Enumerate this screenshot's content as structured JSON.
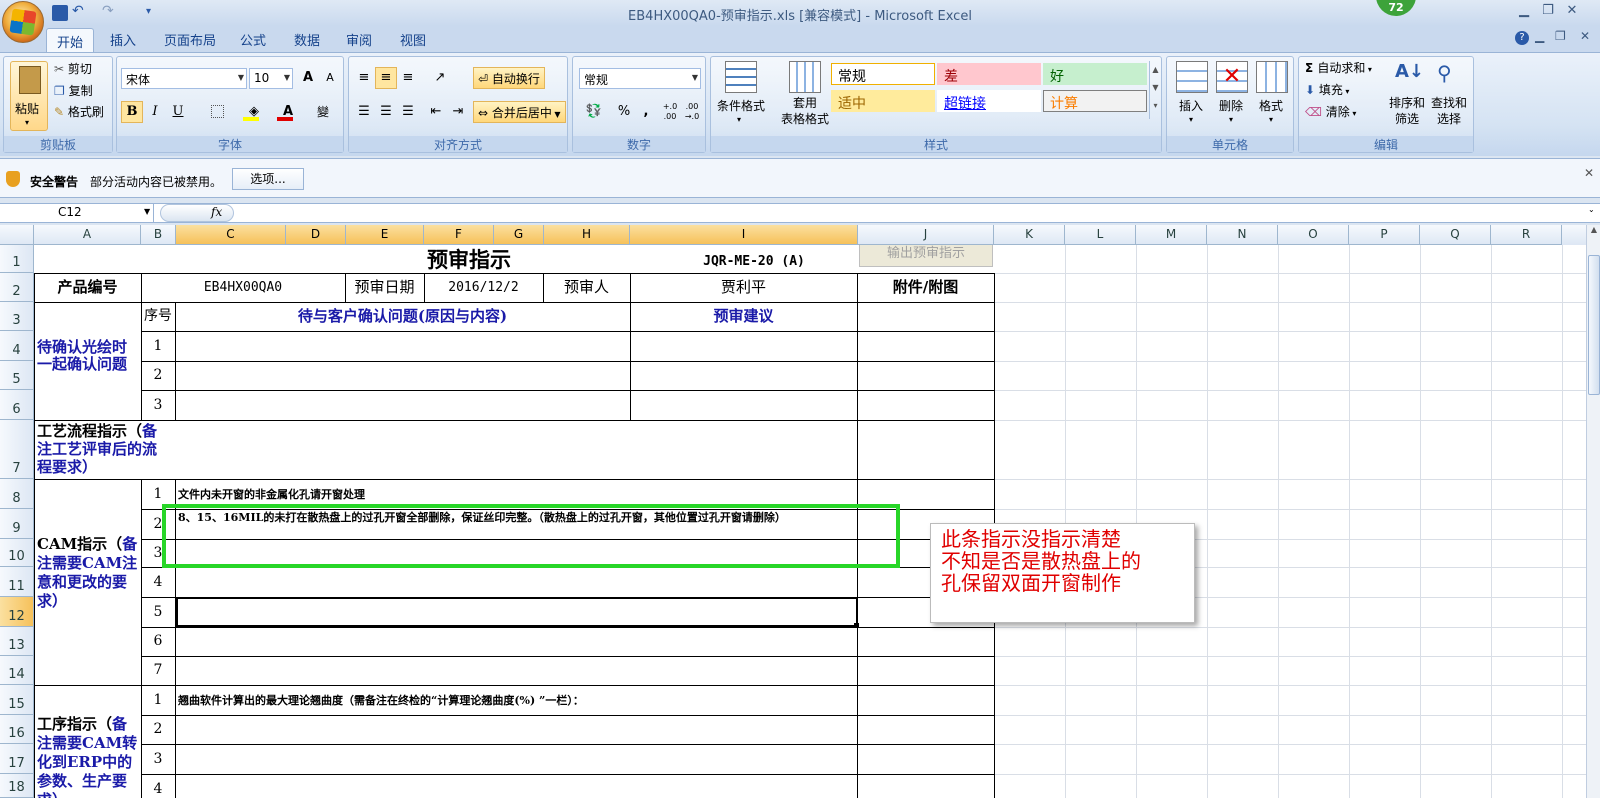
{
  "window": {
    "title": "EB4HX00QA0-预审指示.xls  [兼容模式] - Microsoft Excel",
    "badge": "72",
    "min": "▭",
    "restore": "❐",
    "close": "✕"
  },
  "ribbon_tabs": [
    "开始",
    "插入",
    "页面布局",
    "公式",
    "数据",
    "审阅",
    "视图"
  ],
  "clipboard": {
    "paste": "粘贴",
    "cut": "剪切",
    "copy": "复制",
    "format_painter": "格式刷",
    "label": "剪贴板"
  },
  "font": {
    "name": "宋体",
    "size": "10",
    "grow": "A",
    "shrink": "A",
    "bold": "B",
    "italic": "I",
    "underline": "U",
    "phonetic": "變",
    "label": "字体",
    "font_color": "#e00000",
    "fill_color": "#ffff00"
  },
  "alignment": {
    "wrap": "自动换行",
    "merge": "合并后居中",
    "label": "对齐方式"
  },
  "number": {
    "format": "常规",
    "percent": "%",
    "comma": ",",
    "inc": "+.0 .00",
    "dec": ".00 →.0",
    "label": "数字"
  },
  "styles": {
    "cond_format": "条件格式",
    "table_format": "套用\n表格格式",
    "label": "样式",
    "cells": [
      {
        "name": "常规",
        "bg": "#ffffff",
        "fg": "#000000"
      },
      {
        "name": "差",
        "bg": "#ffc7ce",
        "fg": "#9c0006"
      },
      {
        "name": "好",
        "bg": "#c6efce",
        "fg": "#006100"
      },
      {
        "name": "适中",
        "bg": "#ffeb9c",
        "fg": "#9c6500"
      },
      {
        "name": "超链接",
        "bg": "#ffffff",
        "fg": "#0000ff"
      },
      {
        "name": "计算",
        "bg": "#f2f2f2",
        "fg": "#fa7d00"
      }
    ]
  },
  "cells_group": {
    "insert": "插入",
    "delete": "删除",
    "format": "格式",
    "label": "单元格"
  },
  "editing": {
    "autosum": "自动求和",
    "fill": "填充",
    "clear": "清除",
    "sort": "排序和\n筛选",
    "find": "查找和\n选择",
    "label": "编辑"
  },
  "security": {
    "title": "安全警告",
    "message": "部分活动内容已被禁用。",
    "options": "选项..."
  },
  "formula_bar": {
    "name_box": "C12",
    "fx": "fx",
    "value": ""
  },
  "columns": [
    "A",
    "B",
    "C",
    "D",
    "E",
    "F",
    "G",
    "H",
    "I",
    "J",
    "K",
    "L",
    "M",
    "N",
    "O",
    "P",
    "Q",
    "R"
  ],
  "rows": [
    "1",
    "2",
    "3",
    "4",
    "5",
    "6",
    "7",
    "8",
    "9",
    "10",
    "11",
    "12",
    "13",
    "14",
    "15",
    "16",
    "17",
    "18"
  ],
  "sheet": {
    "title": "预审指示",
    "doc_code": "JQR-ME-20 (A)",
    "export_button": "输出预审指示",
    "product_label": "产品编号",
    "product_value": "EB4HX00QA0",
    "date_label": "预审日期",
    "date_value": "2016/12/2",
    "reviewer_label": "预审人",
    "reviewer_value": "贾利平",
    "attachment_label": "附件/附图",
    "seq_label": "序号",
    "issues_header": "待与客户确认问题(原因与内容)",
    "suggest_header": "预审建议",
    "confirm_section": "待确认光绘时一起确认问题",
    "process_section_a": "工艺流程指示（",
    "process_section_b": "备注工艺评审后的流程要求）",
    "cam_section_a": "CAM指示（",
    "cam_section_b": "备注需要CAM注意和更改的要求）",
    "op_section_a": "工序指示（",
    "op_section_b": "备注需要CAM转化到ERP中的参数、生产要求）",
    "n1": "1",
    "n2": "2",
    "n3": "3",
    "n4": "4",
    "n5": "5",
    "n6": "6",
    "n7": "7",
    "cam_1": "文件内未开窗的非金属化孔请开窗处理",
    "cam_2": "8、15、16MIL的未打在散热盘上的过孔开窗全部删除，保证丝印完整。（散热盘上的过孔开窗，其他位置过孔开窗请删除）",
    "op_1": "翘曲软件计算出的最大理论翘曲度（需备注在终检的“计算理论翘曲度(%) ”一栏）："
  },
  "annotation": "此条指示没指示清楚\n不知是否是散热盘上的\n孔保留双面开窗制作"
}
